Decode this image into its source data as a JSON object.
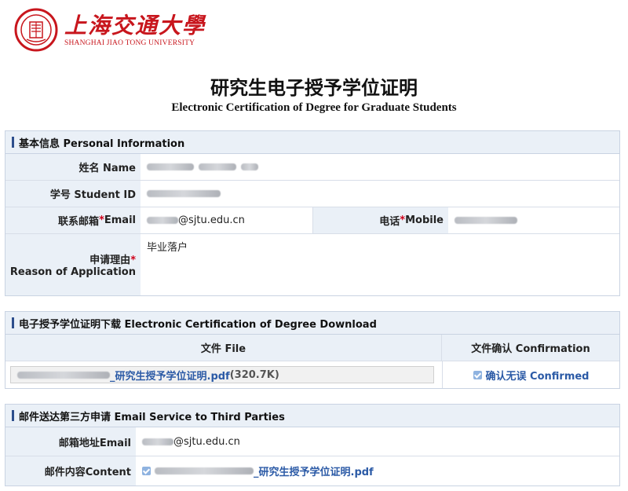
{
  "header": {
    "logo_cn": "上海交通大學",
    "logo_en": "SHANGHAI JIAO TONG UNIVERSITY",
    "title_cn": "研究生电子授予学位证明",
    "title_en": "Electronic Certification of Degree for Graduate Students"
  },
  "personal": {
    "heading": "基本信息 Personal Information",
    "name_label": "姓名 Name",
    "student_id_label": "学号 Student ID",
    "email_label_cn": "联系邮箱",
    "email_label_en": " Email",
    "email_value": "@sjtu.edu.cn",
    "mobile_label_cn": "电话",
    "mobile_label_en": " Mobile",
    "reason_label_cn": "申请理由",
    "reason_label_en": "Reason of Application",
    "reason_value": "毕业落户",
    "required_mark": "*"
  },
  "download": {
    "heading": "电子授予学位证明下载 Electronic Certification of Degree Download",
    "col_file": "文件 File",
    "col_confirm": "文件确认 Confirmation",
    "file_name": "_研究生授予学位证明.pdf",
    "file_size": "(320.7K)",
    "confirm_text": "确认无误 Confirmed"
  },
  "email_service": {
    "heading": "邮件送达第三方申请 Email Service to Third Parties",
    "address_label": "邮箱地址Email",
    "address_value": "@sjtu.edu.cn",
    "content_label": "邮件内容Content",
    "content_file": "_研究生授予学位证明.pdf"
  },
  "colors": {
    "brand_red": "#c8161d",
    "accent_blue": "#2d4e8c",
    "link_blue": "#2b5aa6",
    "header_bg": "#eaf0f7"
  }
}
